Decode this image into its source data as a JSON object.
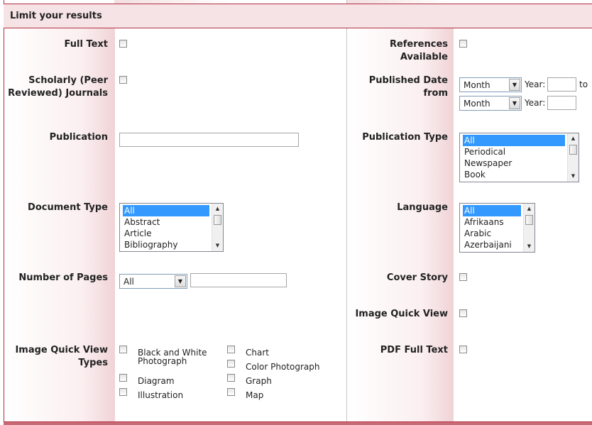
{
  "header": {
    "title": "Limit your results"
  },
  "left": {
    "full_text": {
      "label": "Full Text"
    },
    "scholarly": {
      "label_line1": "Scholarly (Peer",
      "label_line2": "Reviewed) Journals"
    },
    "publication": {
      "label": "Publication",
      "value": ""
    },
    "document_type": {
      "label": "Document Type",
      "options": [
        "All",
        "Abstract",
        "Article",
        "Bibliography"
      ],
      "selected": "All"
    },
    "number_of_pages": {
      "label": "Number of Pages",
      "select_value": "All",
      "value": ""
    },
    "iqv_types": {
      "label_line1": "Image Quick View",
      "label_line2": "Types",
      "types": [
        {
          "line1": "Black and White",
          "line2": "Photograph"
        },
        {
          "line1": "Chart"
        },
        {
          "line1": "Color Photograph"
        },
        {
          "line1": "Diagram"
        },
        {
          "line1": "Graph"
        },
        {
          "line1": "Illustration"
        },
        {
          "line1": "Map"
        }
      ]
    }
  },
  "right": {
    "references": {
      "label": "References Available"
    },
    "published_date": {
      "label": "Published Date from",
      "month1": "Month",
      "month2": "Month",
      "year_label": "Year:",
      "to_label": "to"
    },
    "publication_type": {
      "label": "Publication Type",
      "options": [
        "All",
        "Periodical",
        "Newspaper",
        "Book"
      ],
      "selected": "All"
    },
    "language": {
      "label": "Language",
      "options": [
        "All",
        "Afrikaans",
        "Arabic",
        "Azerbaijani"
      ],
      "selected": "All"
    },
    "cover_story": {
      "label": "Cover Story"
    },
    "image_quick_view": {
      "label": "Image Quick View"
    },
    "pdf_full_text": {
      "label": "PDF Full Text"
    }
  },
  "colors": {
    "accent": "#b32e3f",
    "header_bg": "#f6e3e5",
    "selection": "#3399ff"
  }
}
